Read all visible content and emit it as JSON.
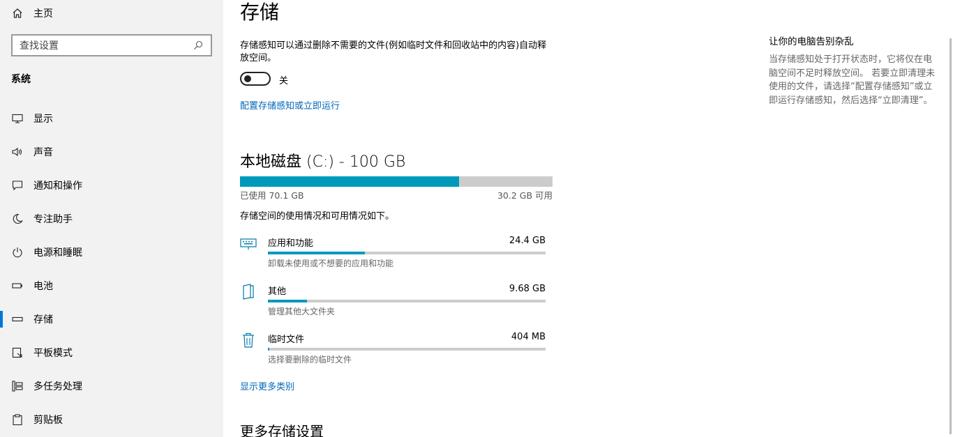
{
  "sidebar": {
    "home_label": "主页",
    "search_placeholder": "查找设置",
    "section_title": "系统",
    "items": [
      {
        "label": "显示",
        "icon": "monitor-icon"
      },
      {
        "label": "声音",
        "icon": "speaker-icon"
      },
      {
        "label": "通知和操作",
        "icon": "notification-icon"
      },
      {
        "label": "专注助手",
        "icon": "moon-icon"
      },
      {
        "label": "电源和睡眠",
        "icon": "power-icon"
      },
      {
        "label": "电池",
        "icon": "battery-icon"
      },
      {
        "label": "存储",
        "icon": "storage-icon",
        "active": true
      },
      {
        "label": "平板模式",
        "icon": "tablet-icon"
      },
      {
        "label": "多任务处理",
        "icon": "multitask-icon"
      },
      {
        "label": "剪贴板",
        "icon": "clipboard-icon"
      }
    ]
  },
  "main": {
    "title": "存储",
    "storage_sense_desc": "存储感知可以通过删除不需要的文件(例如临时文件和回收站中的内容)自动释放空间。",
    "toggle_state_label": "关",
    "toggle_on": false,
    "configure_link": "配置存储感知或立即运行",
    "disk": {
      "title": "本地磁盘 (C:) - 100 GB",
      "used_label": "已使用 70.1 GB",
      "free_label": "30.2 GB 可用",
      "used_fraction": 0.7
    },
    "usage_desc": "存储空间的使用情况和可用情况如下。",
    "categories": [
      {
        "name": "应用和功能",
        "size": "24.4 GB",
        "sub": "卸载未使用或不想要的应用和功能",
        "fraction": 0.35,
        "icon": "keyboard-icon"
      },
      {
        "name": "其他",
        "size": "9.68 GB",
        "sub": "管理其他大文件夹",
        "fraction": 0.14,
        "icon": "document-icon"
      },
      {
        "name": "临时文件",
        "size": "404 MB",
        "sub": "选择要删除的临时文件",
        "fraction": 0.005,
        "icon": "trash-icon"
      }
    ],
    "show_more_link": "显示更多类别",
    "more_settings_title": "更多存储设置"
  },
  "aside": {
    "title": "让你的电脑告别杂乱",
    "text": "当存储感知处于打开状态时，它将仅在电脑空间不足时释放空间。 若要立即清理未使用的文件，请选择“配置存储感知”或立即运行存储感知，然后选择“立即清理”。"
  },
  "colors": {
    "accent": "#0099bc",
    "link": "#0067b8",
    "sidebar_bg": "#f2f2f2"
  }
}
